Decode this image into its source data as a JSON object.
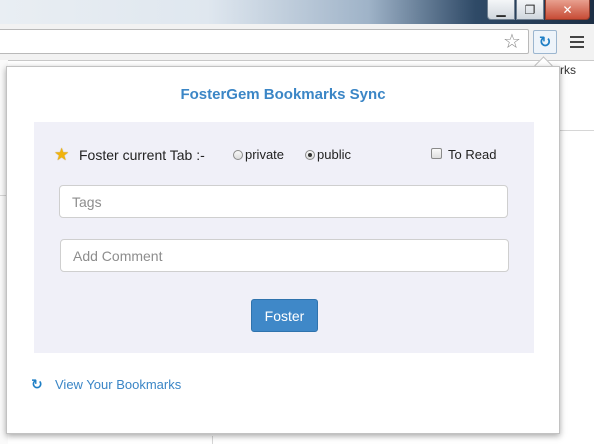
{
  "window": {
    "controls": {
      "minimize": "▁",
      "maximize": "❐",
      "close": "✕"
    }
  },
  "toolbar": {
    "bookmark_star_icon": "star-outline-icon",
    "extension_icon": "foster-sync-icon",
    "menu_icon": "hamburger-menu-icon"
  },
  "background_page": {
    "fragment_text": "rks"
  },
  "popup": {
    "title": "FosterGem Bookmarks Sync",
    "foster_label": "Foster current Tab :-",
    "visibility": {
      "options": [
        {
          "label": "private",
          "checked": false
        },
        {
          "label": "public",
          "checked": true
        }
      ]
    },
    "to_read": {
      "label": "To Read",
      "checked": false
    },
    "tags_input": {
      "value": "",
      "placeholder": "Tags"
    },
    "comment_input": {
      "value": "",
      "placeholder": "Add Comment"
    },
    "foster_button": "Foster",
    "view_link": "View Your Bookmarks",
    "colors": {
      "accent": "#3b86c6",
      "button": "#3f88c8",
      "panel_bg": "#f0f0f8",
      "star": "#f1b30d"
    }
  }
}
